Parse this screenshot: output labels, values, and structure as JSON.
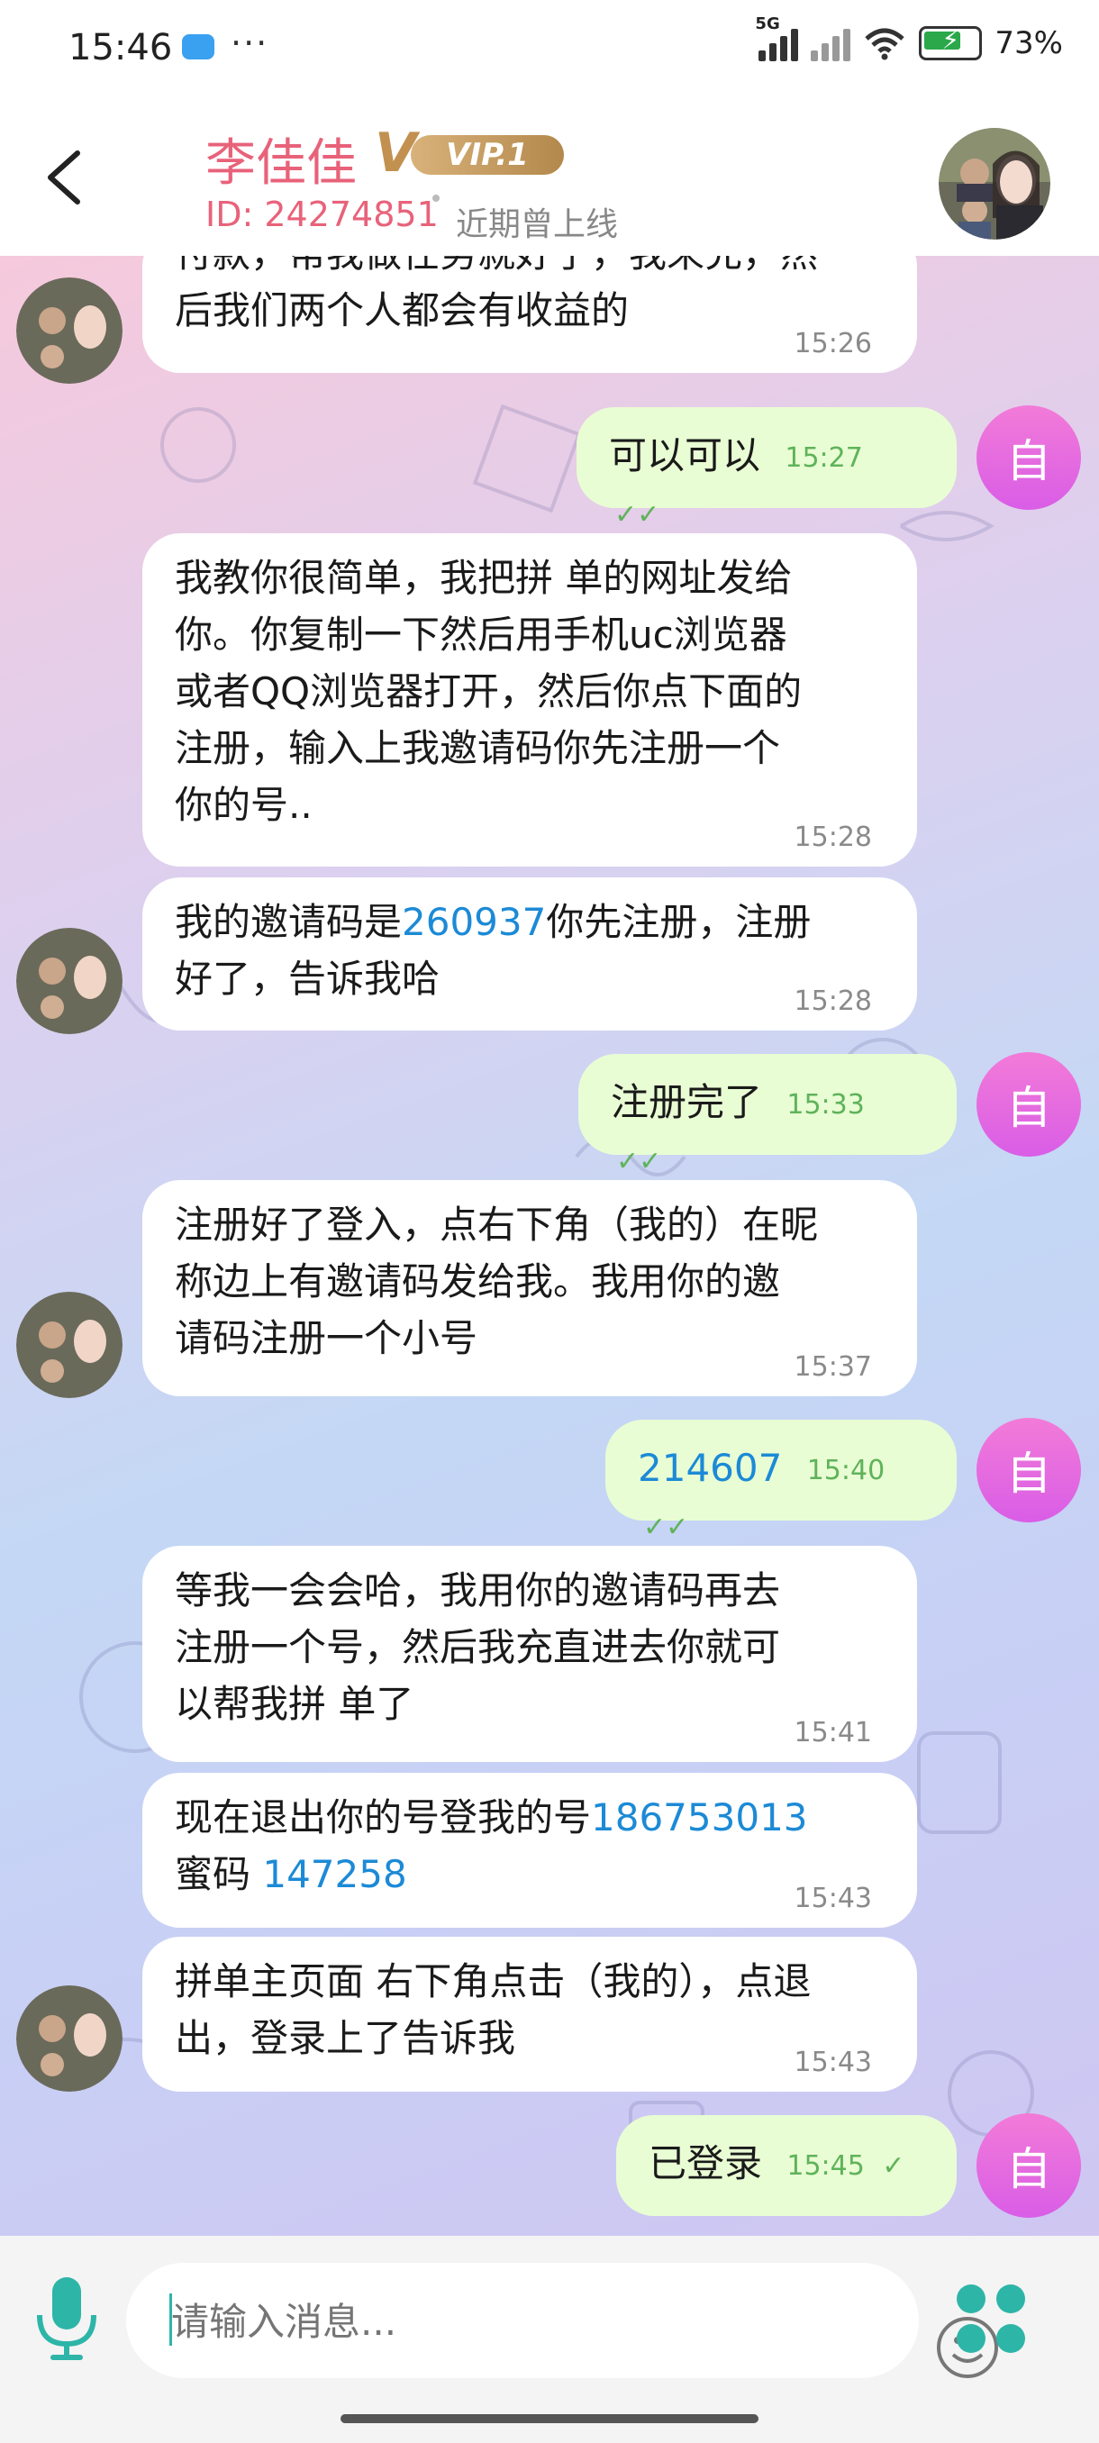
{
  "status_bar": {
    "time": "15:46",
    "network": "5G",
    "battery": "73%"
  },
  "header": {
    "contact_name": "李佳佳",
    "vip_label": "VIP.1",
    "user_id": "ID: 24274851",
    "online_status": "近期曾上线"
  },
  "messages": [
    {
      "side": "in",
      "lines": [
        "付款，帮我做任务就好了，我来充，然",
        "后我们两个人都会有收益的"
      ],
      "time": "15:26"
    },
    {
      "side": "out",
      "text": "可以可以",
      "time": "15:27",
      "self_label": "自"
    },
    {
      "side": "in",
      "lines": [
        "我教你很简单，我把拼 单的网址发给",
        "你。你复制一下然后用手机uc浏览器",
        "或者QQ浏览器打开，然后你点下面的",
        "注册，输入上我邀请码你先注册一个",
        "你的号.."
      ],
      "time": "15:28"
    },
    {
      "side": "in",
      "pre": "我的邀请码是",
      "link": "260937",
      "post": "你先注册，注册",
      "line2": "好了，告诉我哈",
      "time": "15:28"
    },
    {
      "side": "out",
      "text": "注册完了",
      "time": "15:33",
      "self_label": "自"
    },
    {
      "side": "in",
      "lines": [
        "注册好了登入，点右下角（我的）在昵",
        "称边上有邀请码发给我。我用你的邀",
        "请码注册一个小号"
      ],
      "time": "15:37"
    },
    {
      "side": "out",
      "text": "214607",
      "time": "15:40",
      "self_label": "自"
    },
    {
      "side": "in",
      "lines": [
        "等我一会会哈，我用你的邀请码再去",
        "注册一个号，然后我充直进去你就可",
        "以帮我拼 单了"
      ],
      "time": "15:41"
    },
    {
      "side": "in",
      "pre": "现在退出你的号登我的号",
      "link": "186753013",
      "line2_pre": "蜜码 ",
      "line2_link": "147258",
      "time": "15:43"
    },
    {
      "side": "in",
      "lines": [
        "拼单主页面 右下角点击（我的），点退",
        "出，登录上了告诉我"
      ],
      "time": "15:43"
    },
    {
      "side": "out",
      "text": "已登录",
      "time": "15:45",
      "self_label": "自"
    }
  ],
  "input": {
    "placeholder": "请输入消息..."
  },
  "colors": {
    "accent_pink": "#e8627a",
    "self_avatar": "#e46ae4",
    "outgoing_bubble": "#e9fdd4",
    "link": "#1c8ad6",
    "read_tick": "#5fb35a"
  }
}
